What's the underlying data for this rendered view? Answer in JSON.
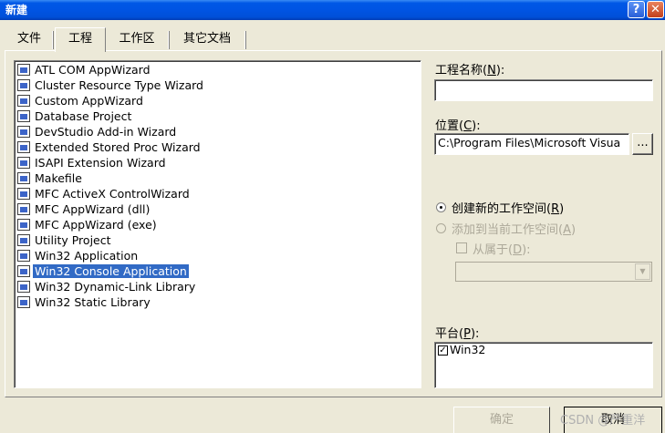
{
  "window": {
    "title": "新建",
    "help_glyph": "?",
    "close_glyph": "✕"
  },
  "tabs": [
    {
      "label": "文件"
    },
    {
      "label": "工程"
    },
    {
      "label": "工作区"
    },
    {
      "label": "其它文档"
    }
  ],
  "project_types": [
    "ATL COM AppWizard",
    "Cluster Resource Type Wizard",
    "Custom AppWizard",
    "Database Project",
    "DevStudio Add-in Wizard",
    "Extended Stored Proc Wizard",
    "ISAPI Extension Wizard",
    "Makefile",
    "MFC ActiveX ControlWizard",
    "MFC AppWizard (dll)",
    "MFC AppWizard (exe)",
    "Utility Project",
    "Win32 Application",
    "Win32 Console Application",
    "Win32 Dynamic-Link Library",
    "Win32 Static Library"
  ],
  "selected_project_type": "Win32 Console Application",
  "project_name": {
    "label": "工程名称",
    "accel": "N",
    "value": ""
  },
  "location": {
    "label": "位置",
    "accel": "C",
    "value": "C:\\Program Files\\Microsoft Visua",
    "browse_label": "..."
  },
  "workspace_options": {
    "create_new": {
      "label": "创建新的工作空间",
      "accel": "R",
      "checked": true
    },
    "add_to_current": {
      "label": "添加到当前工作空间",
      "accel": "A",
      "checked": false,
      "disabled": true
    },
    "dependency": {
      "label": "从属于",
      "accel": "D",
      "checked": false,
      "disabled": true
    }
  },
  "platform": {
    "label": "平台",
    "accel": "P",
    "items": [
      {
        "label": "Win32",
        "checked": true
      }
    ]
  },
  "buttons": {
    "ok": "确定",
    "cancel": "取消"
  },
  "watermark": "CSDN @严重洋",
  "colors": {
    "titlebar": "#0054e3",
    "selection": "#316ac5",
    "dialog_bg": "#ece9d8"
  }
}
